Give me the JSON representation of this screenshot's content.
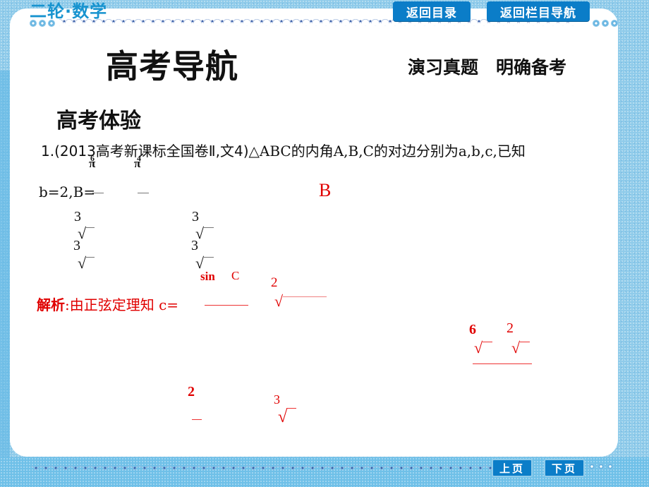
{
  "header": {
    "brand": "二轮·数学",
    "nav_buttons": [
      {
        "label": "返回目录"
      },
      {
        "label": "返回栏目导航"
      }
    ]
  },
  "main": {
    "title": "高考导航",
    "subtitle": "演习真题　明确备考",
    "section_title": "高考体验",
    "question": {
      "number": "1.",
      "source": "(2013高考新课标全国卷Ⅱ,文4)",
      "text": "△ABC的内角A,B,C的对边分别为a,b,c,已知",
      "line2": "b=2,B=",
      "frac_top_1": "π",
      "frac_top_2": "π",
      "frag_6": "6",
      "frag_4": "4",
      "options": [
        {
          "num": "3",
          "coef": "3"
        },
        {
          "num": "3",
          "coef": "3"
        }
      ],
      "answer": "B"
    },
    "analysis": {
      "label": "解析",
      "text": ":由正弦定理知 c=",
      "sin_frag": "sin",
      "c_frag": "C",
      "num_2a": "2",
      "num_6": "6",
      "num_2b": "2",
      "num_2c": "2",
      "num_3": "3"
    }
  },
  "footer": {
    "prev_label": "上页",
    "next_label": "下页"
  },
  "colors": {
    "accent": "#0b7dc8",
    "brand": "#1793cf",
    "answer": "#e00000",
    "frame": "#8fcbea"
  }
}
